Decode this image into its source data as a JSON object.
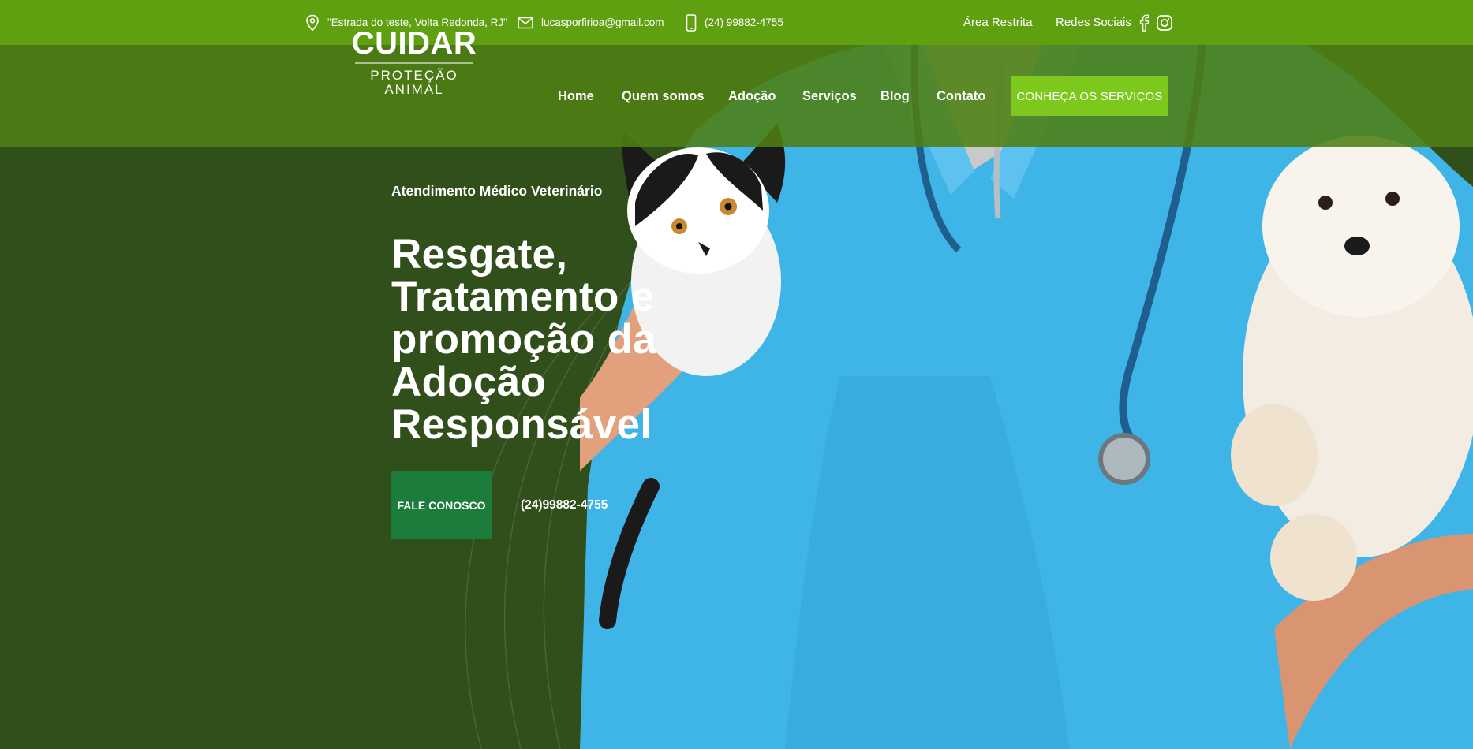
{
  "topbar": {
    "address": "\"Estrada do teste, Volta Redonda, RJ\"",
    "email": "lucasporfirioa@gmail.com",
    "phone": "(24) 99882-4755",
    "restricted_area": "Área Restrita",
    "social_label": "Redes Sociais",
    "address_icon": "map-pin-icon",
    "email_icon": "envelope-icon",
    "phone_icon": "smartphone-icon",
    "social_icons": [
      "facebook-icon",
      "instagram-icon"
    ]
  },
  "logo": {
    "name": "CUIDAR",
    "tagline": "PROTEÇÃO ANIMAL"
  },
  "nav": {
    "items": [
      "Home",
      "Quem somos",
      "Adoção",
      "Serviços",
      "Blog",
      "Contato"
    ],
    "cta": "CONHEÇA OS SERVIÇOS"
  },
  "hero": {
    "kicker": "Atendimento Médico Veterinário",
    "headline": "Resgate, Tratamento e promoção da Adoção Responsável",
    "button": "FALE CONOSCO",
    "phone": "(24)99882-4755"
  },
  "colors": {
    "topbar": "#5fa010",
    "nav_overlay": "#4f8012",
    "hero_bg": "#304f1b",
    "cta": "#7cc81d",
    "fale_button": "#1c7c3c",
    "scrubs": "#3fb4e6"
  }
}
